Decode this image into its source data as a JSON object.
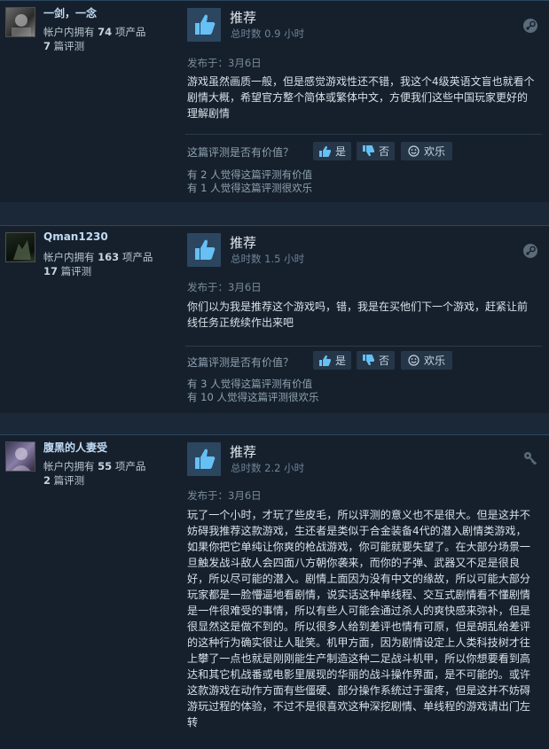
{
  "reviews": [
    {
      "username": "一剑，一念",
      "products_prefix": "帐户内拥有",
      "products_count": "74",
      "products_suffix": "项产品",
      "reviews_count": "7",
      "reviews_suffix": "篇评测",
      "verdict": "推荐",
      "hours": "总时数 0.9 小时",
      "posted": "发布于：3月6日",
      "text": "游戏虽然画质一般，但是感觉游戏性还不错，我这个4级英语文盲也就看个剧情大概，希望官方整个简体或繁体中文，方便我们这些中国玩家更好的理解剧情",
      "helpful_question": "这篇评测是否有价值？",
      "yes": "是",
      "no": "否",
      "funny": "欢乐",
      "helpful_count": "有 2 人觉得这篇评测有价值",
      "funny_count": "有 1 人觉得这篇评测很欢乐",
      "corner_icon": "steam-icon"
    },
    {
      "username": "Qman1230",
      "products_prefix": "帐户内拥有",
      "products_count": "163",
      "products_suffix": "项产品",
      "reviews_count": "17",
      "reviews_suffix": "篇评测",
      "verdict": "推荐",
      "hours": "总时数 1.5 小时",
      "posted": "发布于：3月6日",
      "text": "你们以为我是推荐这个游戏吗，错，我是在买他们下一个游戏，赶紧让前线任务正统续作出来吧",
      "helpful_question": "这篇评测是否有价值？",
      "yes": "是",
      "no": "否",
      "funny": "欢乐",
      "helpful_count": "有 3 人觉得这篇评测有价值",
      "funny_count": "有 10 人觉得这篇评测很欢乐",
      "corner_icon": "steam-icon"
    },
    {
      "username": "腹黑的人妻受",
      "products_prefix": "帐户内拥有",
      "products_count": "55",
      "products_suffix": "项产品",
      "reviews_count": "2",
      "reviews_suffix": "篇评测",
      "verdict": "推荐",
      "hours": "总时数 2.2 小时",
      "posted": "发布于：3月6日",
      "text": "玩了一个小时，才玩了些皮毛，所以评测的意义也不是很大。但是这并不妨碍我推荐这款游戏，生还者是类似于合金装备4代的潜入剧情类游戏，如果你把它单纯让你爽的枪战游戏，你可能就要失望了。在大部分场景一旦触发战斗敌人会四面八方朝你袭来，而你的子弹、武器又不足是很良好，所以尽可能的潜入。剧情上面因为没有中文的缘故，所以可能大部分玩家都是一脸懵逼地看剧情，说实话这种单线程、交互式剧情看不懂剧情是一件很难受的事情，所以有些人可能会通过杀人的爽快感来弥补，但是很显然这是做不到的。所以很多人给到差评也情有可原，但是胡乱给差评的这种行为确实很让人耻笑。机甲方面，因为剧情设定上人类科技树才往上攀了一点也就是刚刚能生产制造这种二足战斗机甲，所以你想要看到高达和其它机战番或电影里展现的华丽的战斗操作界面，是不可能的。或许这款游戏在动作方面有些僵硬、部分操作系统过于蛋疼，但是这并不妨碍游玩过程的体验，不过不是很喜欢这种深挖剧情、单线程的游戏请出门左转",
      "corner_icon": "key-icon"
    }
  ]
}
